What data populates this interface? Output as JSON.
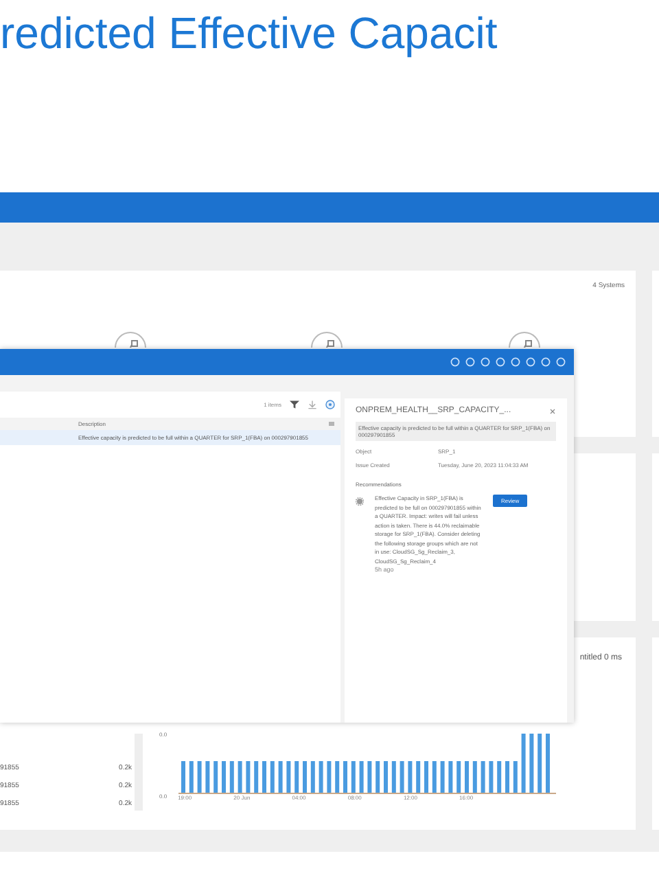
{
  "slide_title": "redicted Effective Capacit",
  "dashboard": {
    "systems_count": "4 Systems",
    "chart_card": {
      "title": "ntitled 0 ms",
      "rows": [
        {
          "name": "91855",
          "value": "0.2k"
        },
        {
          "name": "91855",
          "value": "0.2k"
        },
        {
          "name": "91855",
          "value": "0.2k"
        }
      ],
      "y_ticks": [
        "0.0",
        "0.0"
      ],
      "x_labels": [
        "19:00",
        "20 Jun",
        "04:00",
        "08:00",
        "12:00",
        "16:00"
      ]
    }
  },
  "window": {
    "item_count": "1 items",
    "columns": [
      "Description"
    ],
    "rows": [
      {
        "description": "Effective capacity is predicted to be full within a QUARTER for SRP_1(FBA) on 000297901855",
        "selected": true
      }
    ],
    "detail": {
      "title": "ONPREM_HEALTH__SRP_CAPACITY_...",
      "summary": "Effective capacity is predicted to be full within a QUARTER for SRP_1(FBA) on 000297901855",
      "fields": [
        {
          "label": "Object",
          "value": "SRP_1"
        },
        {
          "label": "Issue Created",
          "value": "Tuesday, June 20, 2023 11:04:33 AM"
        }
      ],
      "recommendations_label": "Recommendations",
      "recommendation": "Effective Capacity in SRP_1(FBA) is predicted to be full on 000297901855 within a QUARTER. Impact: writes will fail unless action is taken. There is 44.0% reclaimable storage for SRP_1(FBA). Consider deleting the following storage groups which are not in use: CloudSG_Sg_Reclaim_3, CloudSG_Sg_Reclaim_4",
      "age": "5h ago",
      "action": "Review"
    }
  }
}
